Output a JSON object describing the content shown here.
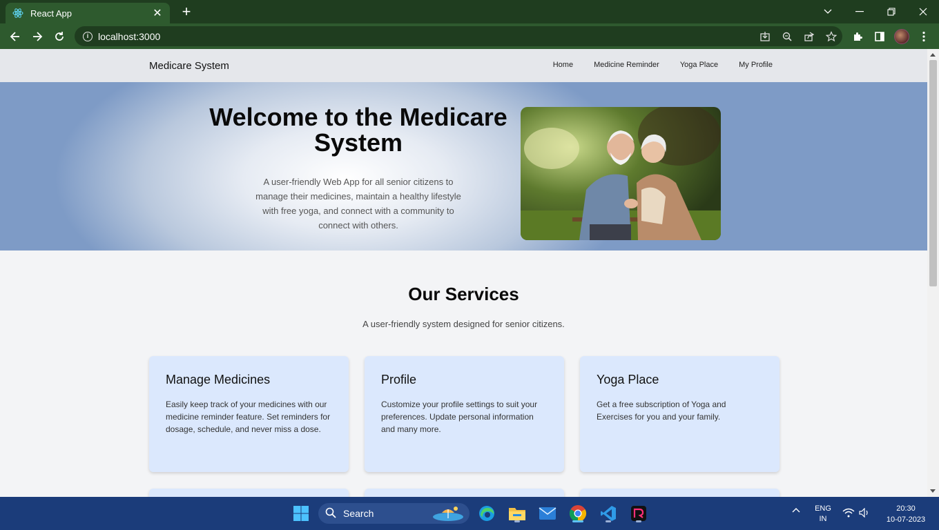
{
  "browser": {
    "tab_title": "React App",
    "url": "localhost:3000",
    "tab_icon": "react-logo-icon"
  },
  "site": {
    "brand": "Medicare System",
    "nav": [
      "Home",
      "Medicine Reminder",
      "Yoga Place",
      "My Profile"
    ]
  },
  "hero": {
    "title": "Welcome to the Medicare System",
    "subtitle": "A user-friendly Web App for all senior citizens to manage their medicines, maintain a healthy lifestyle with free yoga, and connect with a community to connect with others."
  },
  "services": {
    "title": "Our Services",
    "subtitle": "A user-friendly system designed for senior citizens.",
    "cards": [
      {
        "title": "Manage Medicines",
        "text": "Easily keep track of your medicines with our medicine reminder feature. Set reminders for dosage, schedule, and never miss a dose."
      },
      {
        "title": "Profile",
        "text": "Customize your profile settings to suit your preferences. Update personal information and many more."
      },
      {
        "title": "Yoga Place",
        "text": "Get a free subscription of Yoga and Exercises for you and your family."
      }
    ]
  },
  "taskbar": {
    "search_label": "Search",
    "lang": "ENG",
    "region": "IN",
    "time": "20:30",
    "date": "10-07-2023"
  },
  "colors": {
    "browser_frame": "#1f3d1f",
    "browser_toolbar": "#2e5a2e",
    "site_nav": "#e5e7eb",
    "card_bg": "#dbe8fd",
    "taskbar": "#1b3c7a"
  }
}
